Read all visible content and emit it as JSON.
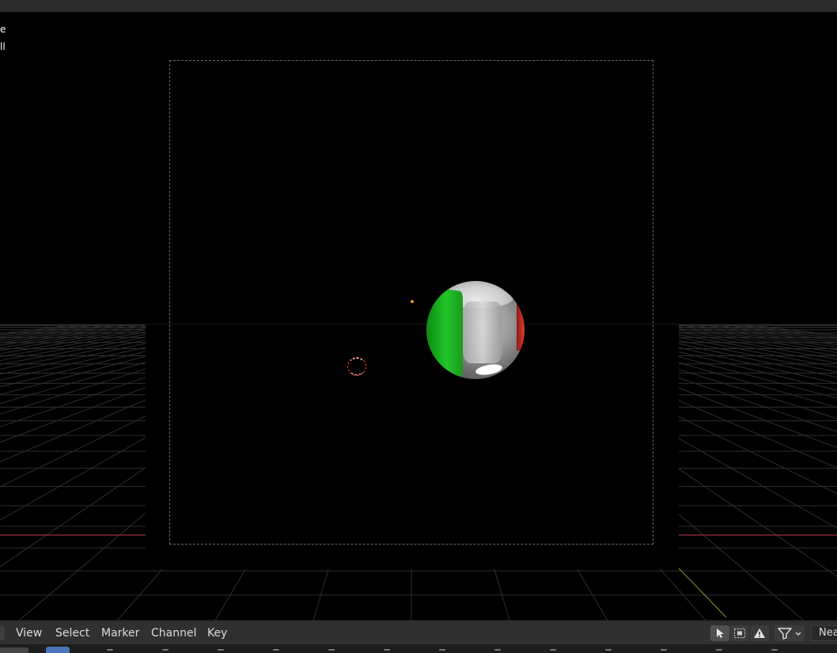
{
  "viewport": {
    "overlay_lines": [
      "e",
      "ll"
    ],
    "colors": {
      "background": "#000000",
      "grid": "#3a3a3a",
      "x_axis": "#9b2f3c",
      "y_axis": "#6b8f2a",
      "camera_frame": "#6a6a6a",
      "origin": "#e8902a",
      "cursor": "#ff3b3b",
      "sphere_green": "#22c428",
      "sphere_red": "#e23a2a"
    }
  },
  "header": {
    "menu": {
      "view": "View",
      "select": "Select",
      "marker": "Marker",
      "channel": "Channel",
      "key": "Key"
    },
    "tools": {
      "select_icon": "cursor-arrow-icon",
      "box_select_icon": "box-select-icon",
      "warning_icon": "warning-icon",
      "filter_icon": "filter-icon",
      "dropdown_icon": "chevron-down-icon"
    },
    "interpolation_label": "Nea"
  },
  "timeline": {
    "current_frame_color": "#4a73b8"
  }
}
